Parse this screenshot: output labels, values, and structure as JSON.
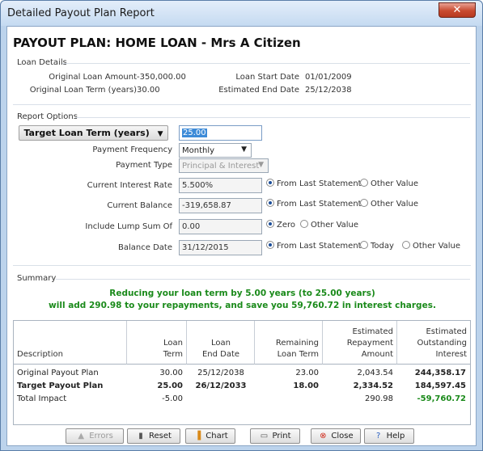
{
  "window": {
    "title": "Detailed Payout Plan Report",
    "close_symbol": "✕"
  },
  "heading": "PAYOUT PLAN: HOME LOAN - Mrs A Citizen",
  "loan_details": {
    "section_label": "Loan Details",
    "original_loan_amount_label": "Original Loan Amount",
    "original_loan_amount": "-350,000.00",
    "original_loan_term_label": "Original Loan Term (years)",
    "original_loan_term": "30.00",
    "loan_start_date_label": "Loan Start Date",
    "loan_start_date": "01/01/2009",
    "estimated_end_date_label": "Estimated End Date",
    "estimated_end_date": "25/12/2038"
  },
  "report_options": {
    "section_label": "Report Options",
    "target_button_label": "Target Loan Term (years)",
    "target_value": "25.00",
    "payment_frequency_label": "Payment Frequency",
    "payment_frequency": "Monthly",
    "payment_type_label": "Payment Type",
    "payment_type": "Principal & Interest",
    "interest_rate_label": "Current Interest Rate",
    "interest_rate": "5.500%",
    "interest_rate_options": [
      "From Last Statement",
      "Other Value"
    ],
    "current_balance_label": "Current Balance",
    "current_balance": "-319,658.87",
    "current_balance_options": [
      "From Last Statement",
      "Other Value"
    ],
    "lump_sum_label": "Include Lump Sum Of",
    "lump_sum": "0.00",
    "lump_sum_options": [
      "Zero",
      "Other Value"
    ],
    "balance_date_label": "Balance Date",
    "balance_date": "31/12/2015",
    "balance_date_options": [
      "From Last Statement",
      "Today",
      "Other Value"
    ]
  },
  "summary": {
    "section_label": "Summary",
    "line1": "Reducing your loan term by 5.00 years (to 25.00 years)",
    "line2": "will add 290.98 to your repayments, and save you 59,760.72 in interest charges."
  },
  "table": {
    "headers": [
      [
        "Description"
      ],
      [
        "Loan",
        "Term"
      ],
      [
        "Loan",
        "End Date"
      ],
      [
        "Remaining",
        "Loan Term"
      ],
      [
        "Estimated",
        "Repayment",
        "Amount"
      ],
      [
        "Estimated",
        "Outstanding",
        "Interest"
      ]
    ],
    "rows": [
      [
        "Original Payout Plan",
        "30.00",
        "25/12/2038",
        "23.00",
        "2,043.54",
        "244,358.17"
      ],
      [
        "Target Payout Plan",
        "25.00",
        "26/12/2033",
        "18.00",
        "2,334.52",
        "184,597.45"
      ],
      [
        "Total Impact",
        "-5.00",
        "",
        "",
        "290.98",
        "-59,760.72"
      ]
    ]
  },
  "buttons": {
    "errors": "Errors",
    "reset": "Reset",
    "chart": "Chart",
    "print": "Print",
    "close": "Close",
    "help": "Help"
  },
  "colors": {
    "accent_green": "#1a8a1a",
    "selection_blue": "#3d8bd8",
    "close_red": "#c84a2f"
  }
}
